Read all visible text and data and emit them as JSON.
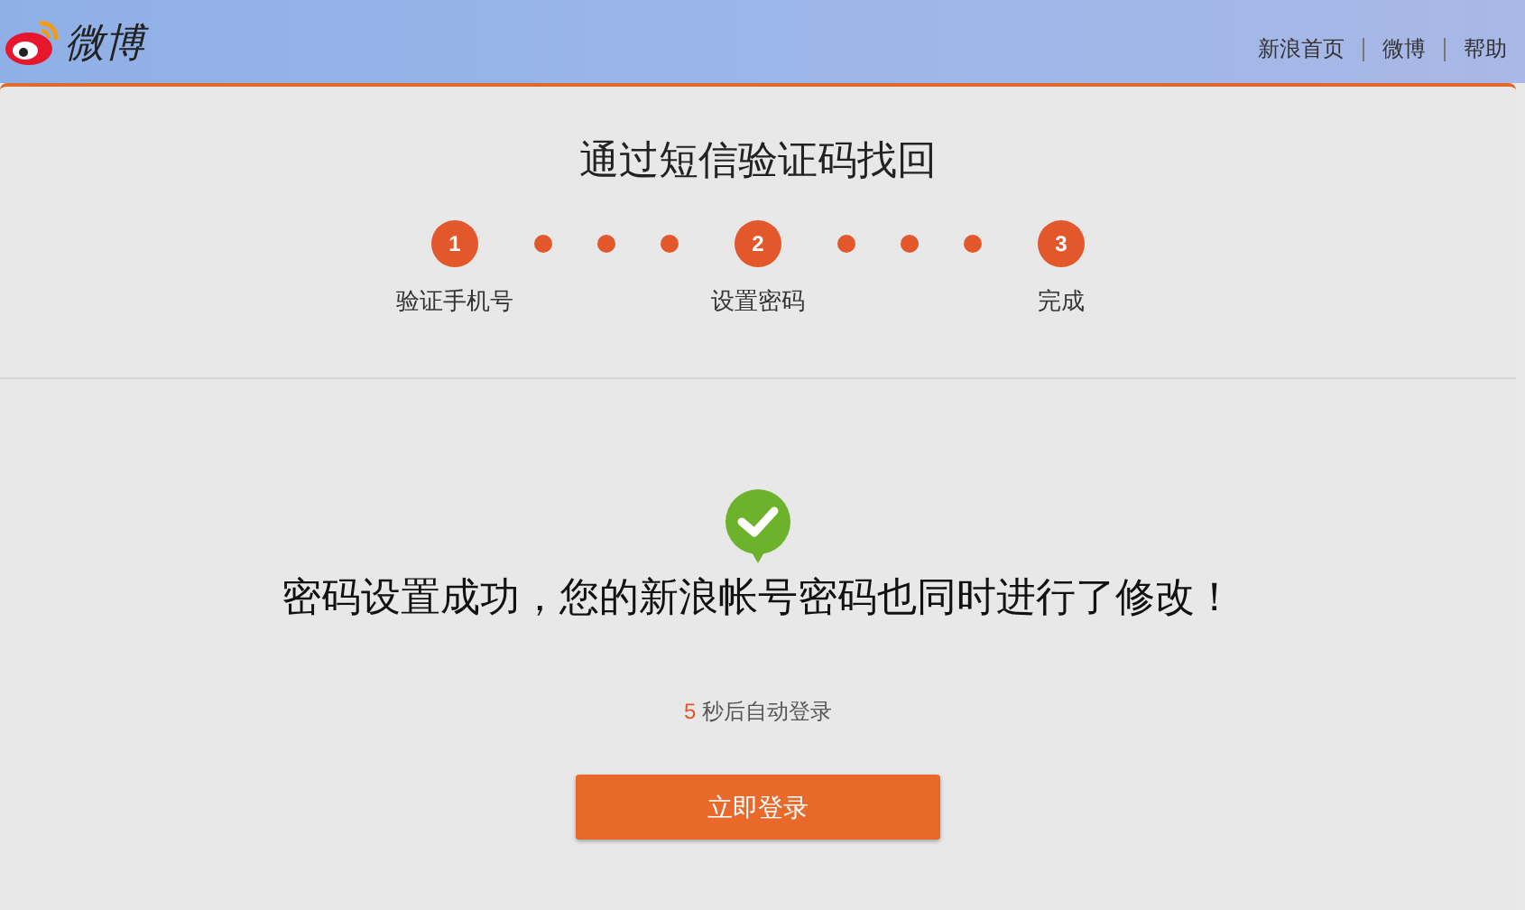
{
  "header": {
    "logo_text": "微博",
    "nav": [
      "新浪首页",
      "微博",
      "帮助"
    ]
  },
  "title": "通过短信验证码找回",
  "steps": [
    {
      "number": "1",
      "label": "验证手机号",
      "done": true
    },
    {
      "number": "2",
      "label": "设置密码",
      "done": true
    },
    {
      "number": "3",
      "label": "完成",
      "done": true
    }
  ],
  "message": "密码设置成功，您的新浪帐号密码也同时进行了修改！",
  "countdown": {
    "seconds": "5",
    "text": "秒后自动登录"
  },
  "login_button": "立即登录"
}
